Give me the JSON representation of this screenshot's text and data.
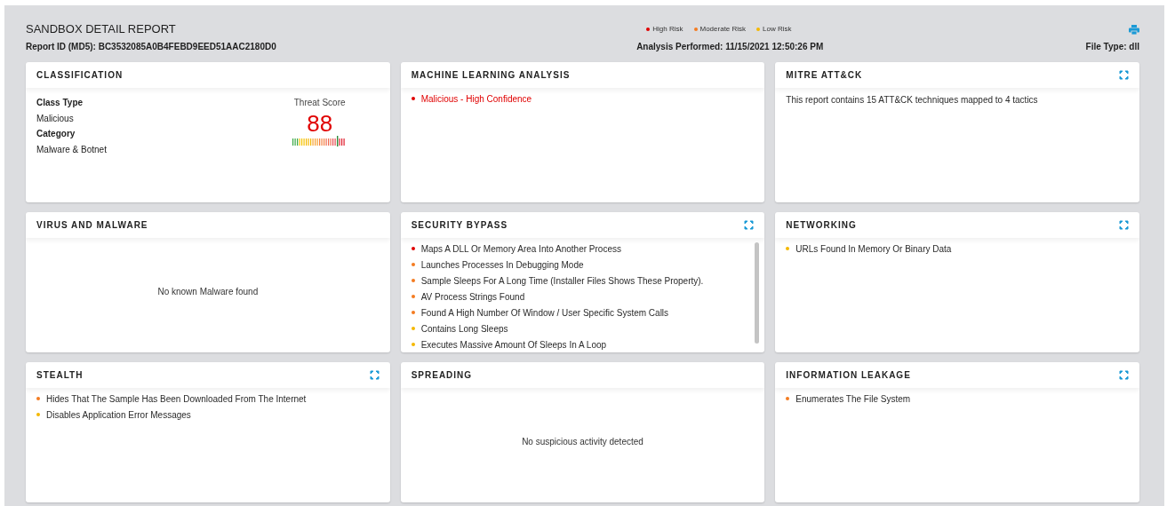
{
  "header": {
    "title": "SANDBOX DETAIL REPORT",
    "report_id": "Report ID (MD5): BC3532085A0B4FEBD9EED51AAC2180D0",
    "analysis": "Analysis Performed: 11/15/2021 12:50:26 PM",
    "file_type": "File Type: dll"
  },
  "legend": [
    {
      "label": "High Risk",
      "color": "#e00000"
    },
    {
      "label": "Moderate Risk",
      "color": "#f47b20"
    },
    {
      "label": "Low Risk",
      "color": "#f5b800"
    }
  ],
  "cards": [
    {
      "kind": "classification",
      "title": "CLASSIFICATION",
      "expandable": false,
      "fields": [
        {
          "label": "Class Type",
          "value": "Malicious"
        },
        {
          "label": "Category",
          "value": "Malware & Botnet"
        }
      ],
      "score_label": "Threat Score",
      "score": "88",
      "level": 0.88
    },
    {
      "kind": "list",
      "title": "MACHINE LEARNING ANALYSIS",
      "expandable": false,
      "scrollable": false,
      "items": [
        {
          "text": "Malicious - High Confidence",
          "color": "#e00000",
          "emphasis": true
        }
      ]
    },
    {
      "kind": "text",
      "title": "MITRE ATT&CK",
      "expandable": true,
      "text": "This report contains 15 ATT&CK techniques mapped to 4 tactics"
    },
    {
      "kind": "empty",
      "title": "VIRUS AND MALWARE",
      "expandable": false,
      "text": "No known Malware found"
    },
    {
      "kind": "list",
      "title": "SECURITY BYPASS",
      "expandable": true,
      "scrollable": true,
      "items": [
        {
          "text": "Maps A DLL Or Memory Area Into Another Process",
          "color": "#e00000",
          "emphasis": false
        },
        {
          "text": "Launches Processes In Debugging Mode",
          "color": "#f47b20",
          "emphasis": false
        },
        {
          "text": "Sample Sleeps For A Long Time (Installer Files Shows These Property).",
          "color": "#f47b20",
          "emphasis": false
        },
        {
          "text": "AV Process Strings Found",
          "color": "#f47b20",
          "emphasis": false
        },
        {
          "text": "Found A High Number Of Window / User Specific System Calls",
          "color": "#f47b20",
          "emphasis": false
        },
        {
          "text": "Contains Long Sleeps",
          "color": "#f5b800",
          "emphasis": false
        },
        {
          "text": "Executes Massive Amount Of Sleeps In A Loop",
          "color": "#f5b800",
          "emphasis": false
        }
      ]
    },
    {
      "kind": "list",
      "title": "NETWORKING",
      "expandable": true,
      "scrollable": false,
      "items": [
        {
          "text": "URLs Found In Memory Or Binary Data",
          "color": "#f5b800",
          "emphasis": false
        }
      ]
    },
    {
      "kind": "list",
      "title": "STEALTH",
      "expandable": true,
      "scrollable": false,
      "items": [
        {
          "text": "Hides That The Sample Has Been Downloaded From The Internet",
          "color": "#f47b20",
          "emphasis": false
        },
        {
          "text": "Disables Application Error Messages",
          "color": "#f5b800",
          "emphasis": false
        }
      ]
    },
    {
      "kind": "empty",
      "title": "SPREADING",
      "expandable": false,
      "text": "No suspicious activity detected"
    },
    {
      "kind": "list",
      "title": "INFORMATION LEAKAGE",
      "expandable": true,
      "scrollable": false,
      "items": [
        {
          "text": "Enumerates The File System",
          "color": "#f47b20",
          "emphasis": false
        }
      ]
    }
  ]
}
